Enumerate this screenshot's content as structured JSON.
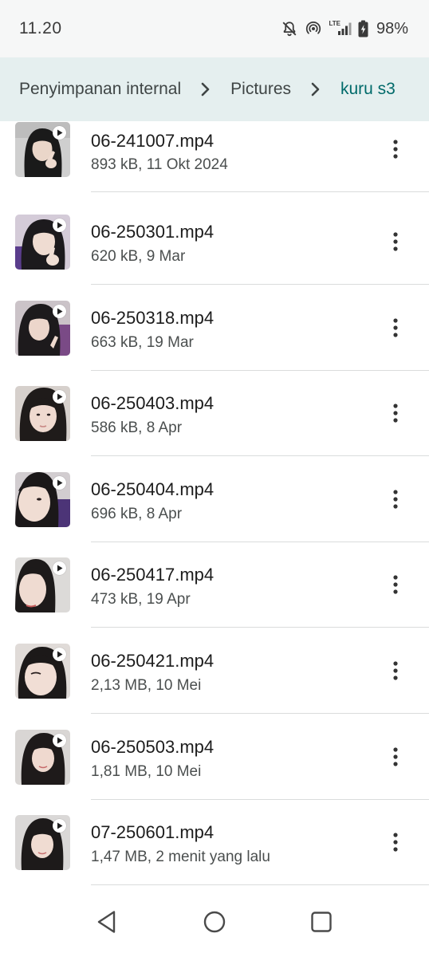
{
  "status_bar": {
    "time": "11.20",
    "network_label": "LTE",
    "battery_percent": "98%",
    "icons": [
      "notifications-off-icon",
      "hotspot-icon",
      "lte-signal-icon",
      "battery-charging-icon"
    ]
  },
  "breadcrumb": {
    "items": [
      {
        "label": "Penyimpanan internal",
        "current": false
      },
      {
        "label": "Pictures",
        "current": false
      },
      {
        "label": "kuru s3",
        "current": true
      }
    ],
    "separator_icon": "chevron-right-icon",
    "current_color": "#006a6a"
  },
  "files": [
    {
      "name": "06-241007.mp4",
      "meta": "893 kB, 11 Okt 2024"
    },
    {
      "name": "06-250301.mp4",
      "meta": "620 kB, 9 Mar"
    },
    {
      "name": "06-250318.mp4",
      "meta": "663 kB, 19 Mar"
    },
    {
      "name": "06-250403.mp4",
      "meta": "586 kB, 8 Apr"
    },
    {
      "name": "06-250404.mp4",
      "meta": "696 kB, 8 Apr"
    },
    {
      "name": "06-250417.mp4",
      "meta": "473 kB, 19 Apr"
    },
    {
      "name": "06-250421.mp4",
      "meta": "2,13 MB, 10 Mei"
    },
    {
      "name": "06-250503.mp4",
      "meta": "1,81 MB, 10 Mei"
    },
    {
      "name": "07-250601.mp4",
      "meta": "1,47 MB, 2 menit yang lalu"
    }
  ],
  "file_item_icons": {
    "thumbnail_badge": "play-icon",
    "menu": "more-vert-icon"
  },
  "nav_bar": {
    "icons": [
      "back-icon",
      "home-icon",
      "recents-icon"
    ]
  },
  "colors": {
    "breadcrumb_background": "#e5efef",
    "status_bar_background": "#f6f7f7",
    "accent": "#006a6a"
  }
}
